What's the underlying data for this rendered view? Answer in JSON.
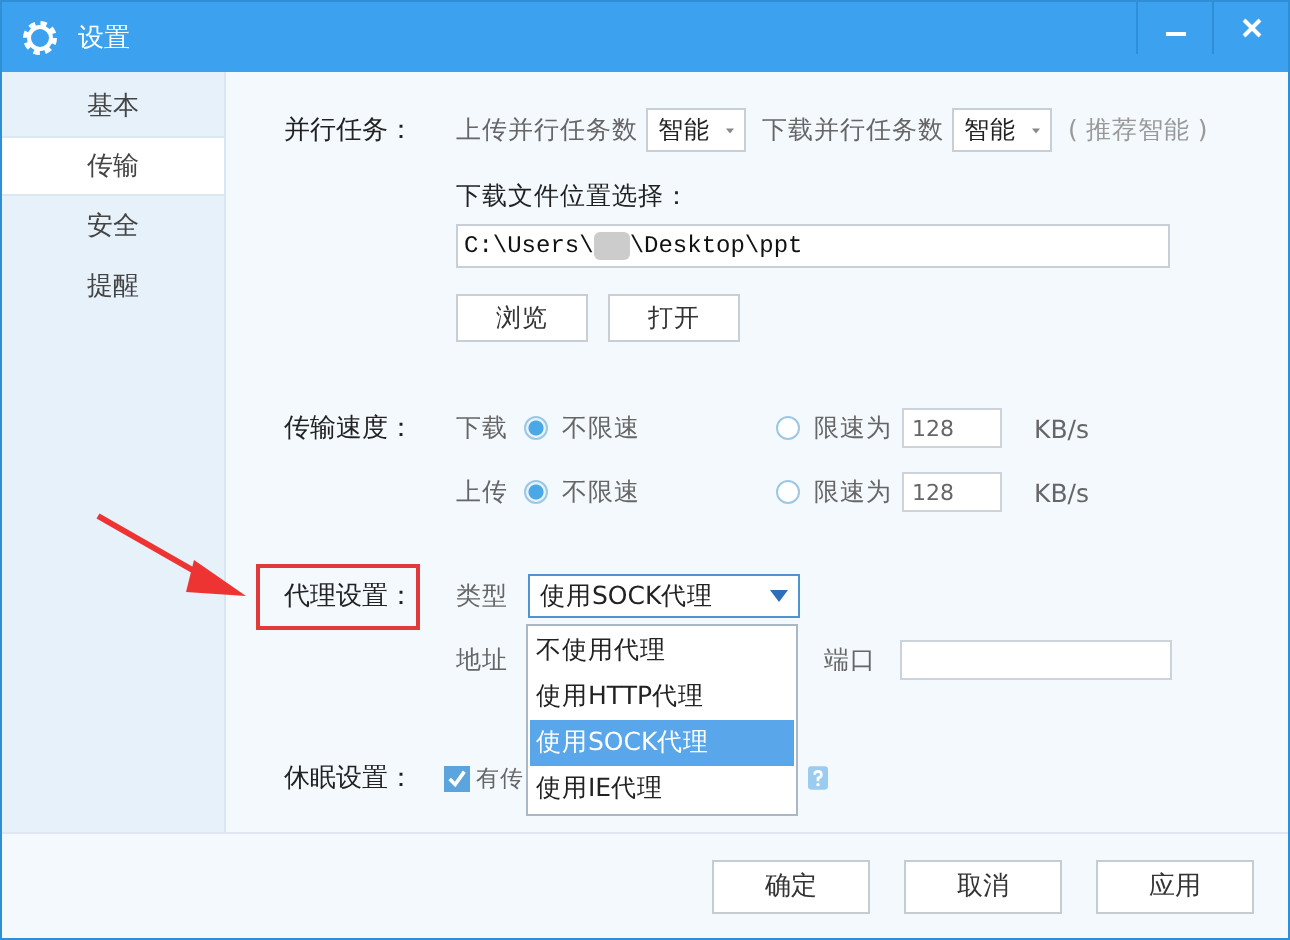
{
  "window": {
    "title": "设置"
  },
  "sidebar": {
    "items": [
      {
        "label": "基本",
        "selected": false
      },
      {
        "label": "传输",
        "selected": true
      },
      {
        "label": "安全",
        "selected": false
      },
      {
        "label": "提醒",
        "selected": false
      }
    ]
  },
  "parallel": {
    "label": "并行任务：",
    "upload_label": "上传并行任务数",
    "upload_value": "智能",
    "download_label": "下载并行任务数",
    "download_value": "智能",
    "hint": "( 推荐智能 )"
  },
  "download_location": {
    "label": "下载文件位置选择：",
    "path_start": "C:\\Users\\",
    "path_end": "\\Desktop\\ppt",
    "buttons": [
      "浏览",
      "打开"
    ]
  },
  "speed": {
    "label": "传输速度：",
    "rows": [
      {
        "direction": "下载",
        "options": [
          {
            "label": "不限速",
            "selected": true
          },
          {
            "label": "限速为",
            "selected": false
          }
        ],
        "limit": "128",
        "unit": "KB/s"
      },
      {
        "direction": "上传",
        "options": [
          {
            "label": "不限速",
            "selected": true
          },
          {
            "label": "限速为",
            "selected": false
          }
        ],
        "limit": "128",
        "unit": "KB/s"
      }
    ]
  },
  "proxy": {
    "label": "代理设置：",
    "type_label": "类型",
    "type_value": "使用SOCK代理",
    "address_label": "地址",
    "port_label": "端口",
    "menu": [
      {
        "label": "不使用代理",
        "selected": false
      },
      {
        "label": "使用HTTP代理",
        "selected": false
      },
      {
        "label": "使用SOCK代理",
        "selected": true
      },
      {
        "label": "使用IE代理",
        "selected": false
      }
    ]
  },
  "sleep": {
    "label": "休眠设置：",
    "checked": true,
    "text": "有传"
  },
  "footer": {
    "buttons": [
      "确定",
      "取消",
      "应用"
    ]
  }
}
